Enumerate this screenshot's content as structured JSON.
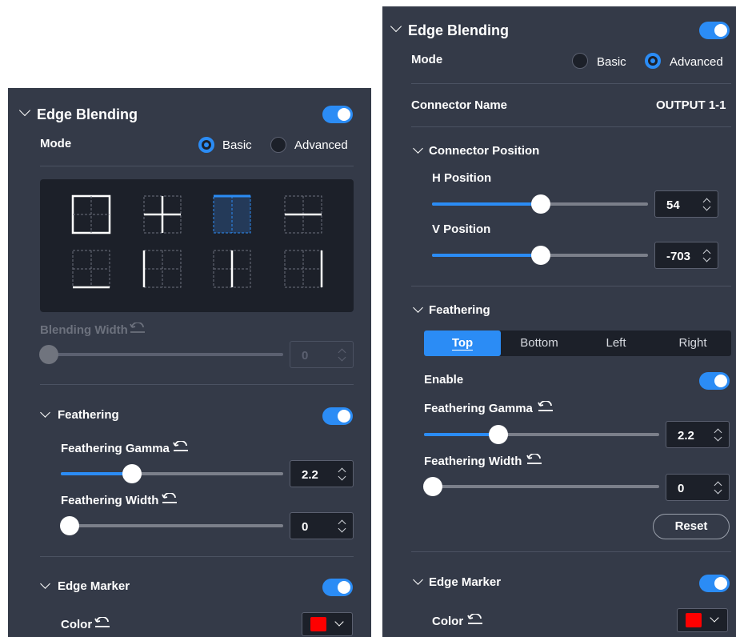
{
  "left": {
    "title": "Edge Blending",
    "mode_label": "Mode",
    "mode_basic": "Basic",
    "mode_advanced": "Advanced",
    "mode_selected": "Basic",
    "blending_width_label": "Blending Width",
    "blending_width_value": "0",
    "feathering_title": "Feathering",
    "gamma_label": "Feathering Gamma",
    "gamma_value": "2.2",
    "gamma_fraction": 0.3,
    "fwidth_label": "Feathering Width",
    "fwidth_value": "0",
    "fwidth_fraction": 0,
    "edge_marker_title": "Edge Marker",
    "color_label": "Color",
    "blend_patterns": [
      "full-frame",
      "cross",
      "top-edge-selected",
      "horizontal-middle",
      "bottom-edge",
      "left-edge",
      "vertical-middle",
      "right-edge"
    ],
    "selected_pattern": "top-edge-selected"
  },
  "right": {
    "title": "Edge Blending",
    "mode_label": "Mode",
    "mode_basic": "Basic",
    "mode_advanced": "Advanced",
    "mode_selected": "Advanced",
    "connector_name_label": "Connector Name",
    "connector_name_value": "OUTPUT 1-1",
    "connector_position_title": "Connector Position",
    "h_label": "H Position",
    "h_value": "54",
    "h_fraction": 0.5,
    "v_label": "V Position",
    "v_value": "-703",
    "v_fraction": 0.5,
    "feathering_title": "Feathering",
    "tabs": [
      "Top",
      "Bottom",
      "Left",
      "Right"
    ],
    "active_tab": "Top",
    "enable_label": "Enable",
    "gamma_label": "Feathering Gamma",
    "gamma_value": "2.2",
    "gamma_fraction": 0.3,
    "fwidth_label": "Feathering Width",
    "fwidth_value": "0",
    "fwidth_fraction": 0,
    "reset_label": "Reset",
    "edge_marker_title": "Edge Marker",
    "color_label": "Color"
  },
  "colors": {
    "accent": "#2b8cf5",
    "panel": "#343a48",
    "field": "#1c2029",
    "marker": "#ff0000"
  }
}
